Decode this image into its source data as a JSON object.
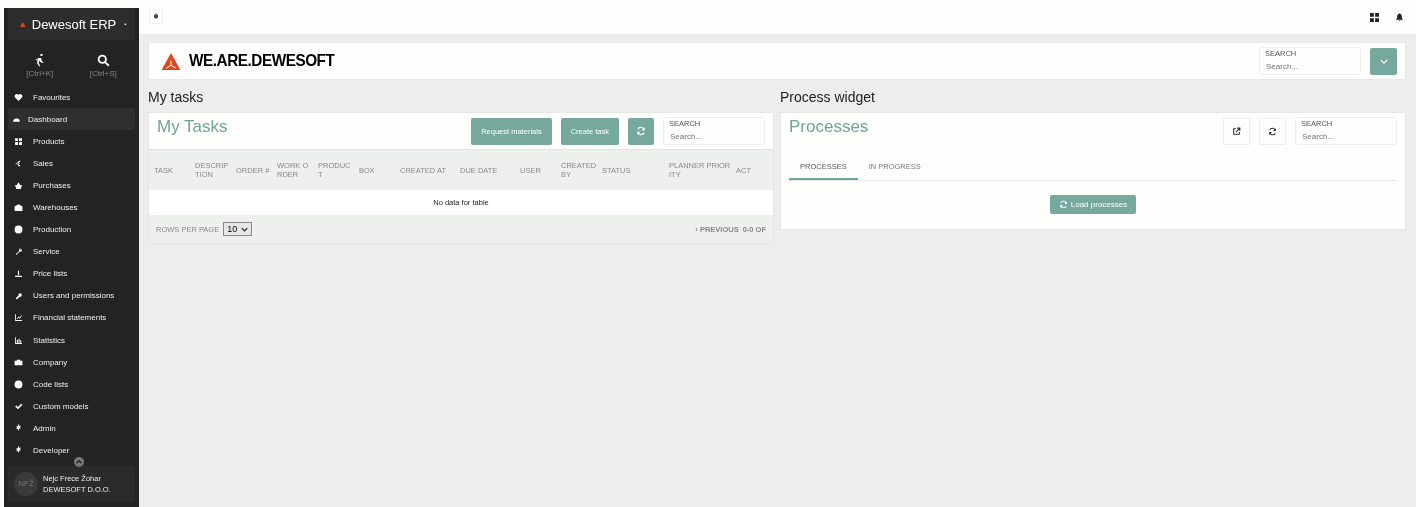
{
  "app": {
    "title": "Dewesoft ERP",
    "shortcuts": [
      "[Ctrl+K]",
      "[Ctrl+S]"
    ]
  },
  "sidebar": {
    "items": [
      {
        "label": "Favourites",
        "selected": false
      },
      {
        "label": "Dashboard",
        "selected": true
      },
      {
        "label": "Products",
        "selected": false
      },
      {
        "label": "Sales",
        "selected": false
      },
      {
        "label": "Purchases",
        "selected": false
      },
      {
        "label": "Warehouses",
        "selected": false
      },
      {
        "label": "Production",
        "selected": false
      },
      {
        "label": "Service",
        "selected": false
      },
      {
        "label": "Price lists",
        "selected": false
      },
      {
        "label": "Users and permissions",
        "selected": false
      },
      {
        "label": "Financial statements",
        "selected": false
      },
      {
        "label": "Statistics",
        "selected": false
      },
      {
        "label": "Company",
        "selected": false
      },
      {
        "label": "Code lists",
        "selected": false
      },
      {
        "label": "Custom models",
        "selected": false
      },
      {
        "label": "Admin",
        "selected": false
      },
      {
        "label": "Developer",
        "selected": false
      }
    ],
    "user": {
      "initials": "NFŽ",
      "name": "Nejc Frece Žohar",
      "company": "DEWESOFT D.O.O."
    }
  },
  "banner": {
    "brand": "WE.ARE.DEWESOFT",
    "search": {
      "label": "SEARCH",
      "placeholder": "Search..."
    }
  },
  "my_tasks": {
    "heading": "My tasks",
    "title": "My Tasks",
    "buttons": [
      "Request materials",
      "Create task"
    ],
    "search": {
      "label": "SEARCH",
      "placeholder": "Search..."
    },
    "columns": [
      "TASK",
      "DESCRIPTION",
      "ORDER #",
      "WORK ORDER",
      "PRODUCT",
      "BOX",
      "CREATED AT",
      "DUE DATE",
      "USER",
      "CREATED BY",
      "STATUS",
      "PLANNER PRIORITY",
      "ACT"
    ],
    "empty": "No data for table",
    "rows_per_page_label": "ROWS PER PAGE",
    "rows_per_page": "10",
    "previous": "‹ PREVIOUS",
    "range": "0-0 OF"
  },
  "process_widget": {
    "heading": "Process widget",
    "title": "Processes",
    "search": {
      "label": "SEARCH",
      "placeholder": "Search..."
    },
    "tabs": [
      {
        "label": "PROCESSES",
        "selected": true
      },
      {
        "label": "IN PROGRESS",
        "selected": false
      }
    ],
    "load_button": "Load processes"
  }
}
